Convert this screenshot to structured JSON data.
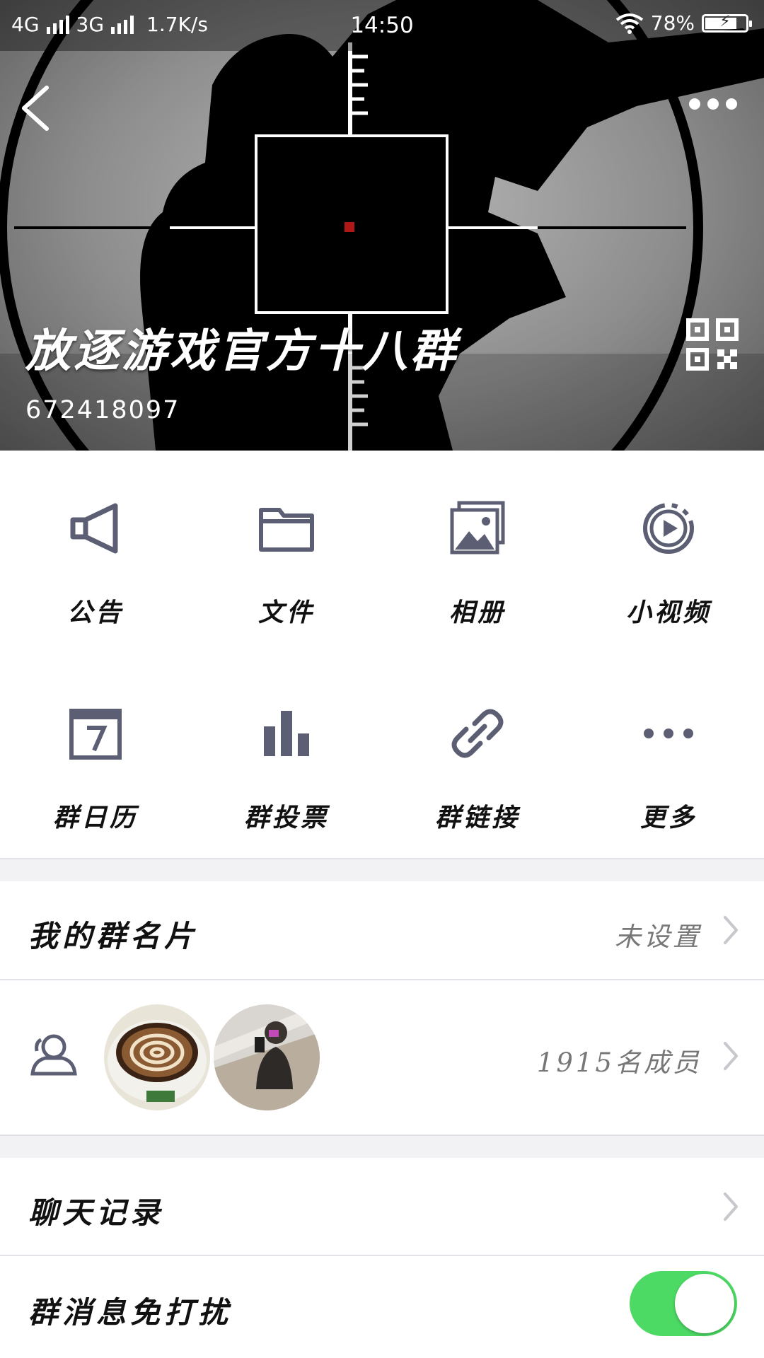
{
  "status_bar": {
    "network1": "4G",
    "network2": "3G",
    "speed": "1.7K/s",
    "time": "14:50",
    "battery_percent": "78%",
    "battery_level": 0.78
  },
  "header": {
    "group_name": "放逐游戏官方十八群",
    "group_id": "672418097"
  },
  "grid": [
    {
      "label": "公告",
      "icon": "megaphone-icon"
    },
    {
      "label": "文件",
      "icon": "folder-icon"
    },
    {
      "label": "相册",
      "icon": "photo-album-icon"
    },
    {
      "label": "小视频",
      "icon": "video-icon"
    },
    {
      "label": "群日历",
      "icon": "calendar-icon"
    },
    {
      "label": "群投票",
      "icon": "vote-chart-icon"
    },
    {
      "label": "群链接",
      "icon": "link-icon"
    },
    {
      "label": "更多",
      "icon": "more-dots-icon"
    }
  ],
  "card_row": {
    "title": "我的群名片",
    "value": "未设置"
  },
  "members_row": {
    "count_text": "1915名成员"
  },
  "chat_history_row": {
    "title": "聊天记录"
  },
  "mute_row": {
    "title": "群消息免打扰",
    "enabled": true
  },
  "colors": {
    "icon_gray": "#5c5f73",
    "toggle_on": "#4cd964",
    "chevron": "#c7c7cc"
  }
}
